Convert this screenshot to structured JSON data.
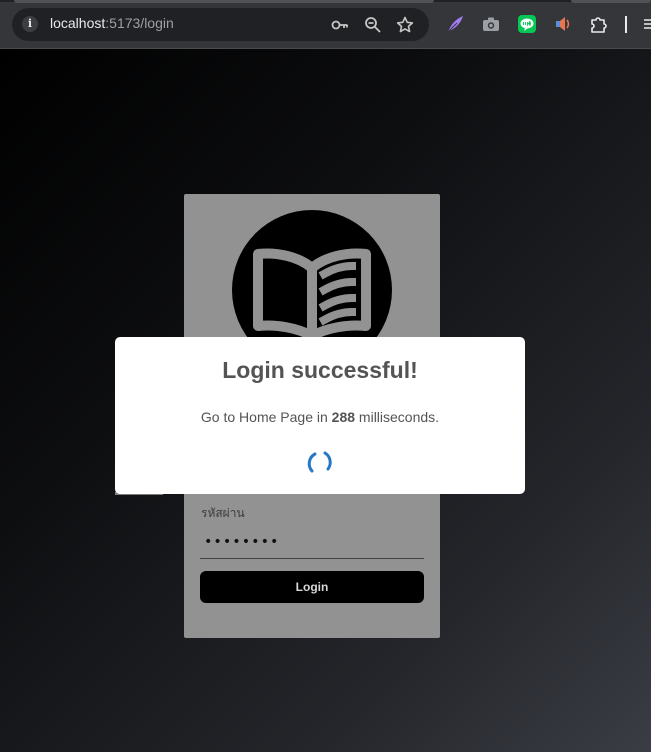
{
  "browser": {
    "url_host": "localhost",
    "url_rest": ":5173/login"
  },
  "icons": {
    "site_info": "info-icon",
    "password_key": "key-icon",
    "zoom": "zoom-icon",
    "bookmark": "star-icon",
    "extensions": [
      "feather-extension-icon",
      "camera-extension-icon",
      "line-extension-icon",
      "speaker-extension-icon",
      "puzzle-extension-icon"
    ],
    "menu": "kebab-menu-icon"
  },
  "login_form": {
    "logo": "open-book-logo",
    "password_label": "รหัสผ่าน",
    "password_value": "••••••••",
    "login_button": "Login"
  },
  "modal": {
    "title": "Login successful!",
    "text_before": "Go to Home Page in",
    "countdown": "288",
    "text_after": "milliseconds."
  },
  "colors": {
    "card_bg": "#929293",
    "modal_bg": "#ffffff",
    "spinner": "#2778c4",
    "line_green": "#06c755"
  }
}
